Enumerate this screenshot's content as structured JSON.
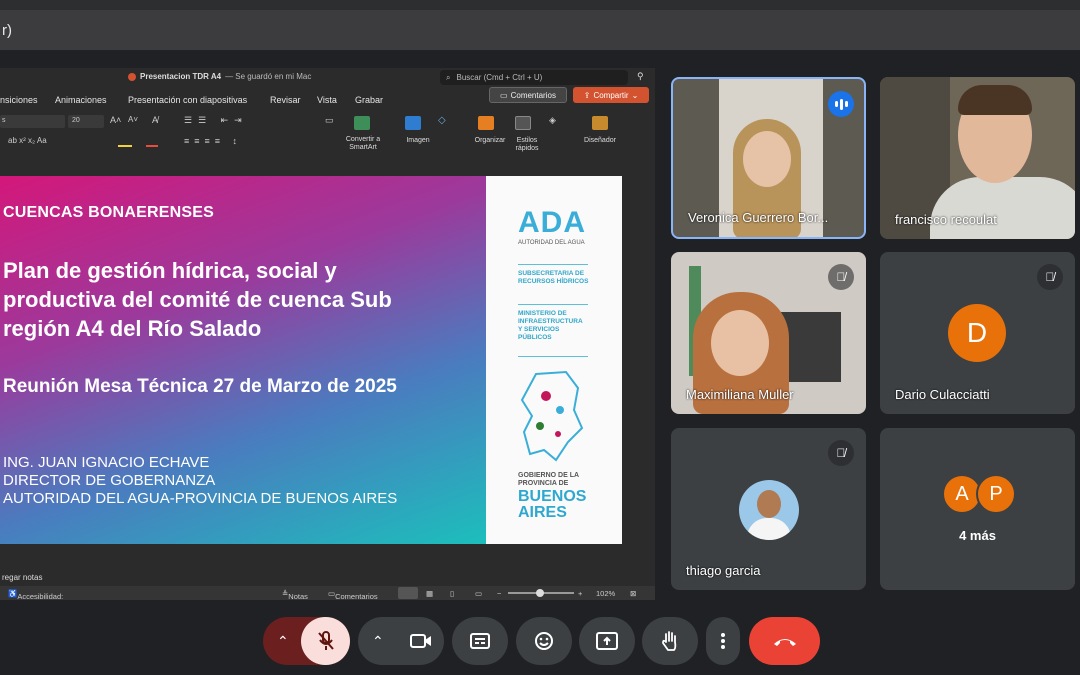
{
  "window": {
    "title_fragment": "r)"
  },
  "ppt": {
    "doc_title": "Presentacion TDR A4",
    "save_status": "— Se guardó en mi Mac",
    "search_placeholder": "Buscar (Cmd + Ctrl + U)",
    "menu": [
      "nsiciones",
      "Animaciones",
      "Presentación con diapositivas",
      "Revisar",
      "Vista",
      "Grabar"
    ],
    "comments_button": "Comentarios",
    "share_button": "Compartir",
    "font_size": "20",
    "ribbon_labels": {
      "smartart": "Convertir a SmartArt",
      "image": "Imagen",
      "arrange": "Organizar",
      "quick_styles": "Estilos rápidos",
      "designer": "Diseñador"
    },
    "add_notes": "regar notas",
    "accessibility": "Accesibilidad: es necesario investigar",
    "notes": "Notas",
    "comments": "Comentarios",
    "zoom": "102%"
  },
  "slide": {
    "heading": "CUENCAS BONAERENSES",
    "title_lines": [
      "Plan de gestión hídrica, social y",
      "productiva del comité de cuenca Sub",
      "región A4 del Río Salado"
    ],
    "meeting": "Reunión Mesa Técnica 27 de Marzo de 2025",
    "credits": [
      "ING. JUAN IGNACIO ECHAVE",
      "DIRECTOR DE GOBERNANZA",
      "AUTORIDAD DEL AGUA-PROVINCIA DE BUENOS AIRES"
    ],
    "logo": "ADA",
    "logo_sub": "AUTORIDAD DEL AGUA",
    "subsecretaria": [
      "SUBSECRETARIA DE",
      "RECURSOS HÍDRICOS"
    ],
    "ministerio": [
      "MINISTERIO DE",
      "INFRAESTRUCTURA",
      "Y SERVICIOS",
      "PÚBLICOS"
    ],
    "gobierno": [
      "GOBIERNO DE LA",
      "PROVINCIA DE"
    ],
    "buenos_aires": [
      "BUENOS",
      "AIRES"
    ]
  },
  "participants": [
    {
      "name": "Veronica Guerrero Bor...",
      "speaking": true
    },
    {
      "name": "francisco recoulat",
      "muted": false
    },
    {
      "name": "Maximiliana Muller",
      "muted": true
    },
    {
      "name": "Dario Culacciatti",
      "initial": "D",
      "muted": true,
      "avatar_color": "#e8710a"
    },
    {
      "name": "thiago garcia",
      "muted": true
    },
    {
      "more_label": "4 más",
      "initials": [
        "A",
        "P"
      ],
      "avatar_color": "#e8710a"
    }
  ],
  "colors": {
    "accent": "#1a73e8",
    "leave": "#ea4335",
    "mic_off_bg": "#f9dedc",
    "share": "#d35230"
  }
}
